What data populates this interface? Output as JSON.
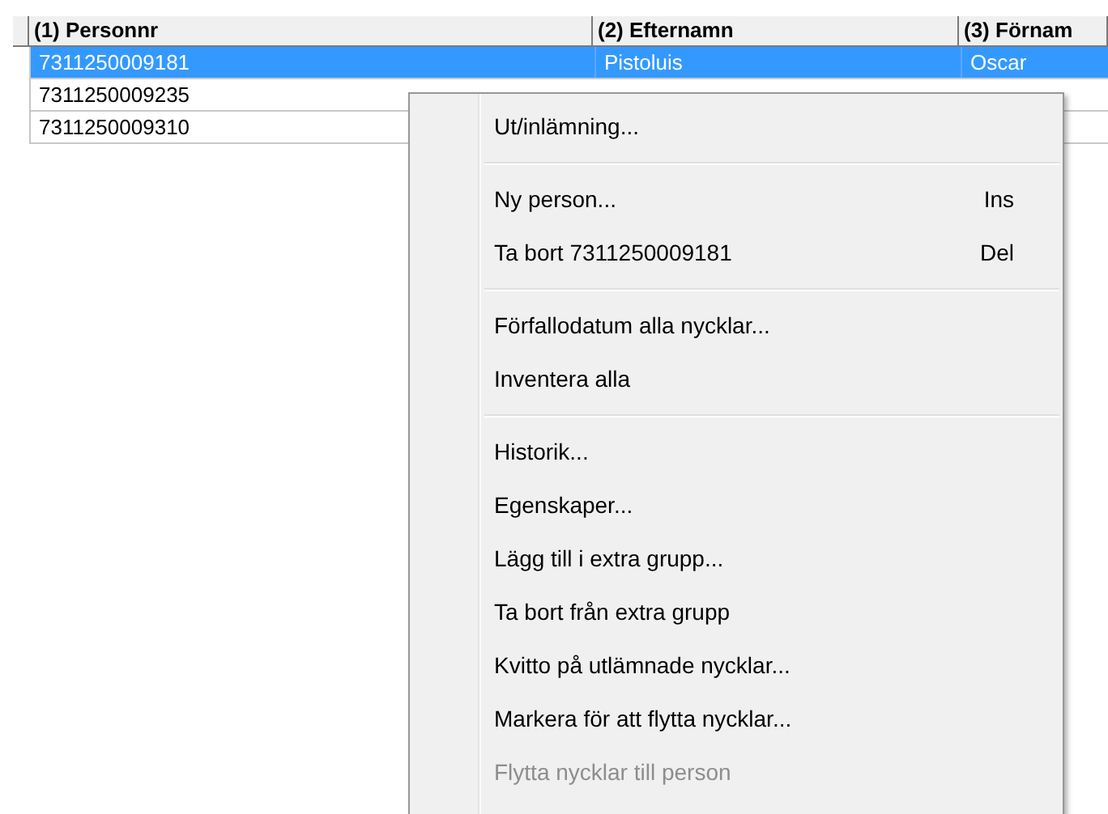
{
  "table": {
    "columns": [
      "(1) Personnr",
      "(2) Efternamn",
      "(3) Förnam"
    ],
    "rows": [
      {
        "selected": true,
        "cells": [
          "7311250009181",
          "Pistoluis",
          "Oscar"
        ]
      },
      {
        "selected": false,
        "cells": [
          "7311250009235"
        ]
      },
      {
        "selected": false,
        "cells": [
          "7311250009310"
        ]
      }
    ]
  },
  "context_menu": {
    "items": [
      {
        "kind": "item",
        "label": "Ut/inlämning...",
        "disabled": false
      },
      {
        "kind": "separator"
      },
      {
        "kind": "item",
        "label": "Ny person...",
        "shortcut": "Ins",
        "disabled": false
      },
      {
        "kind": "item",
        "label": "Ta bort 7311250009181",
        "shortcut": "Del",
        "disabled": false
      },
      {
        "kind": "separator"
      },
      {
        "kind": "item",
        "label": "Förfallodatum alla nycklar...",
        "disabled": false
      },
      {
        "kind": "item",
        "label": "Inventera alla",
        "disabled": false
      },
      {
        "kind": "separator"
      },
      {
        "kind": "item",
        "label": "Historik...",
        "disabled": false
      },
      {
        "kind": "item",
        "label": "Egenskaper...",
        "disabled": false
      },
      {
        "kind": "item",
        "label": "Lägg till i extra grupp...",
        "disabled": false
      },
      {
        "kind": "item",
        "label": "Ta bort från extra grupp",
        "disabled": false
      },
      {
        "kind": "item",
        "label": "Kvitto på utlämnade nycklar...",
        "disabled": false
      },
      {
        "kind": "item",
        "label": "Markera för att flytta nycklar...",
        "disabled": false
      },
      {
        "kind": "item",
        "label": "Flytta nycklar till person",
        "disabled": true
      }
    ]
  }
}
